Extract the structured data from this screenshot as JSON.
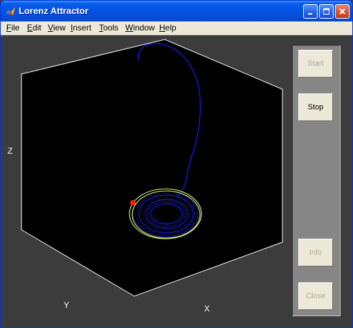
{
  "window": {
    "title": "Lorenz Attractor"
  },
  "menu": [
    {
      "key": "F",
      "rest": "ile"
    },
    {
      "key": "E",
      "rest": "dit"
    },
    {
      "key": "V",
      "rest": "iew"
    },
    {
      "key": "I",
      "rest": "nsert"
    },
    {
      "key": "T",
      "rest": "ools"
    },
    {
      "key": "W",
      "rest": "indow"
    },
    {
      "key": "H",
      "rest": "elp"
    }
  ],
  "plot": {
    "axis_labels": {
      "x": "X",
      "y": "Y",
      "z": "Z"
    },
    "colors": {
      "trajectory": "#1a1aff",
      "ring": "#e0ff60",
      "marker": "#ff1a1a",
      "axes_box": "#ffffff",
      "background": "#000000"
    }
  },
  "panel": {
    "start_label": "Start",
    "stop_label": "Stop",
    "info_label": "Info",
    "close_label": "Close",
    "start_enabled": false,
    "stop_enabled": true,
    "info_enabled": false,
    "close_enabled": false
  }
}
